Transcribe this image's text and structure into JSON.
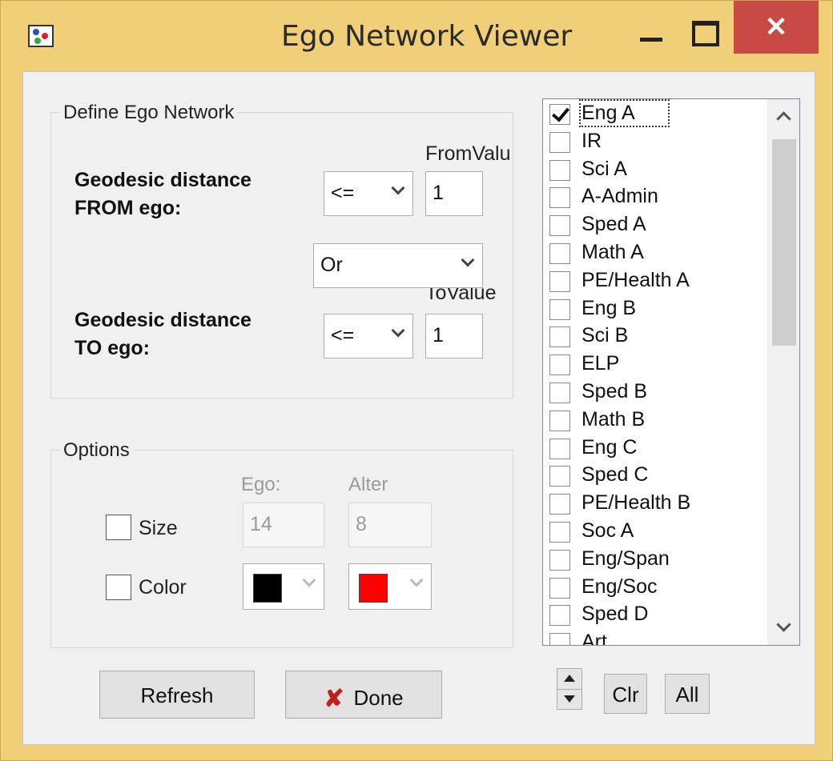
{
  "window": {
    "title": "Ego Network Viewer",
    "close_glyph": "✕"
  },
  "define": {
    "group_title": "Define Ego Network",
    "from_label": "Geodesic distance FROM ego:",
    "from_value_label": "FromValu",
    "from_operator": "<=",
    "from_value": "1",
    "logic": "Or",
    "to_value_label": "ToValue",
    "to_label": "Geodesic distance TO ego:",
    "to_operator": "<=",
    "to_value": "1"
  },
  "options": {
    "group_title": "Options",
    "ego_label": "Ego:",
    "alter_label": "Alter",
    "size_label": "Size",
    "size_checked": false,
    "ego_size": "14",
    "alter_size": "8",
    "color_label": "Color",
    "color_checked": false,
    "ego_color": "#000000",
    "alter_color": "#ff0000"
  },
  "buttons": {
    "refresh": "Refresh",
    "done": "Done",
    "clr": "Clr",
    "all": "All",
    "done_icon": "✘"
  },
  "list": {
    "items": [
      {
        "label": "Eng A",
        "checked": true
      },
      {
        "label": "IR",
        "checked": false
      },
      {
        "label": "Sci A",
        "checked": false
      },
      {
        "label": "A-Admin",
        "checked": false
      },
      {
        "label": "Sped A",
        "checked": false
      },
      {
        "label": "Math A",
        "checked": false
      },
      {
        "label": "PE/Health A",
        "checked": false
      },
      {
        "label": "Eng B",
        "checked": false
      },
      {
        "label": "Sci B",
        "checked": false
      },
      {
        "label": "ELP",
        "checked": false
      },
      {
        "label": "Sped B",
        "checked": false
      },
      {
        "label": "Math B",
        "checked": false
      },
      {
        "label": "Eng C",
        "checked": false
      },
      {
        "label": "Sped C",
        "checked": false
      },
      {
        "label": "PE/Health B",
        "checked": false
      },
      {
        "label": "Soc A",
        "checked": false
      },
      {
        "label": "Eng/Span",
        "checked": false
      },
      {
        "label": "Eng/Soc",
        "checked": false
      },
      {
        "label": "Sped D",
        "checked": false
      },
      {
        "label": "Art",
        "checked": false
      }
    ]
  }
}
